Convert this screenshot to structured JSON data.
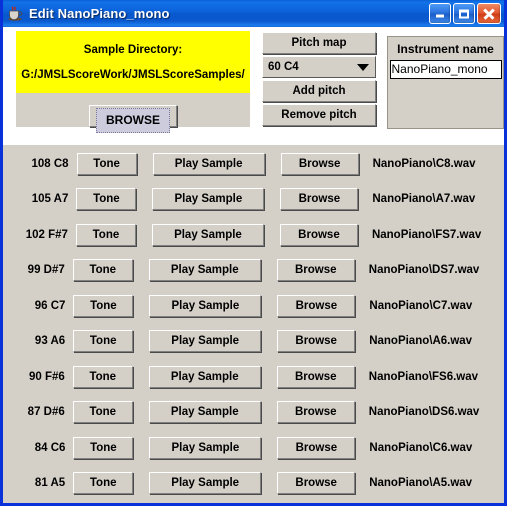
{
  "window": {
    "title": "Edit NanoPiano_mono",
    "icon": "java-coffee-cup-icon",
    "minimize_label": "Minimize",
    "maximize_label": "Maximize",
    "close_label": "Close",
    "titlebar_color": "#0a58cd",
    "panel_color": "#d4d0c8",
    "highlight_color": "#ffff00"
  },
  "sample_directory": {
    "label": "Sample Directory:",
    "path": "G:/JMSLScoreWork/JMSLScoreSamples/",
    "browse_label": "BROWSE"
  },
  "pitch_map": {
    "title_label": "Pitch map",
    "selected": "60 C4",
    "options": [
      "60 C4"
    ],
    "add_label": "Add pitch",
    "remove_label": "Remove pitch"
  },
  "instrument": {
    "label": "Instrument name",
    "value": "NanoPiano_mono",
    "placeholder": ""
  },
  "row_buttons": {
    "tone": "Tone",
    "play": "Play Sample",
    "browse": "Browse"
  },
  "pitch_rows": [
    {
      "label": "108 C8",
      "file": "NanoPiano\\C8.wav"
    },
    {
      "label": "105 A7",
      "file": "NanoPiano\\A7.wav"
    },
    {
      "label": "102 F#7",
      "file": "NanoPiano\\FS7.wav"
    },
    {
      "label": "99 D#7",
      "file": "NanoPiano\\DS7.wav"
    },
    {
      "label": "96 C7",
      "file": "NanoPiano\\C7.wav"
    },
    {
      "label": "93 A6",
      "file": "NanoPiano\\A6.wav"
    },
    {
      "label": "90 F#6",
      "file": "NanoPiano\\FS6.wav"
    },
    {
      "label": "87 D#6",
      "file": "NanoPiano\\DS6.wav"
    },
    {
      "label": "84 C6",
      "file": "NanoPiano\\C6.wav"
    },
    {
      "label": "81 A5",
      "file": "NanoPiano\\A5.wav"
    }
  ]
}
